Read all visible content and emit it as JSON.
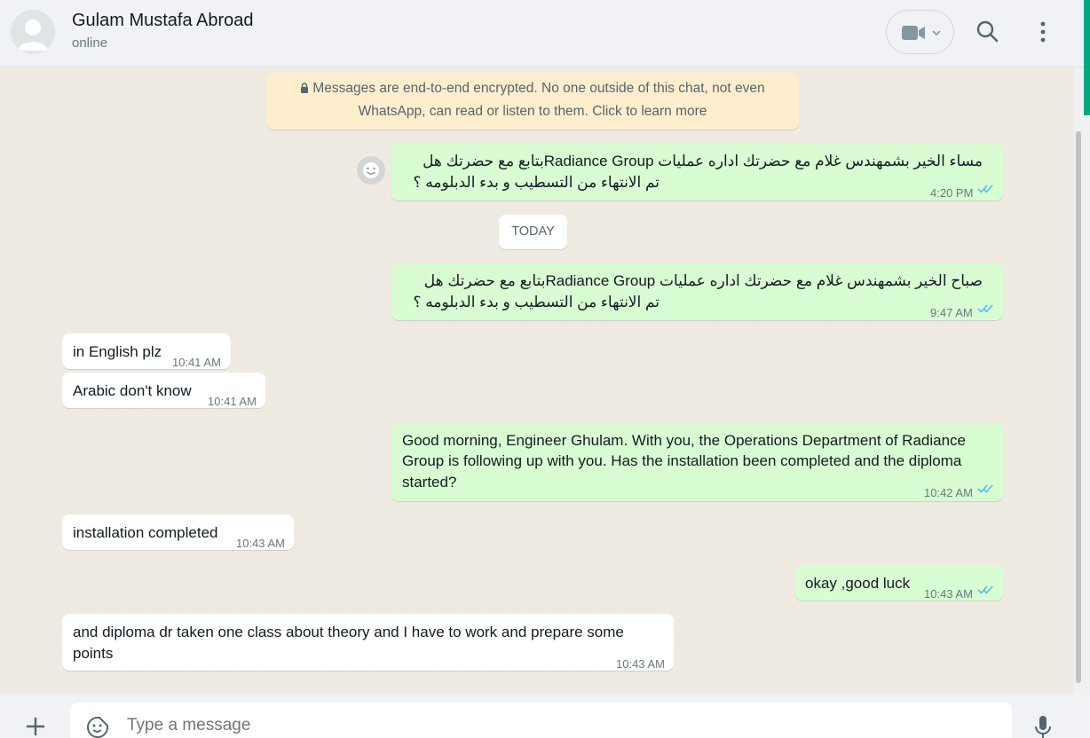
{
  "header": {
    "contact_name": "Gulam Mustafa Abroad",
    "status": "online",
    "icons": [
      "avatar",
      "video-call-icon",
      "chevron-down-icon",
      "search-icon",
      "menu-icon"
    ]
  },
  "encryption_notice": {
    "line1": "Messages are end-to-end encrypted. No one outside of this chat, not even",
    "line2": "WhatsApp, can read or listen to them. Click to learn more"
  },
  "date_separator": "TODAY",
  "messages": [
    {
      "direction": "out",
      "line1": "مساء الخير بشمهندس غلام مع  حضرتك اداره عمليات Radiance Groupبتابع مع حضرتك هل",
      "line2": "تم الانتهاء من التسطيب و بدء الدبلومه ؟",
      "time": "4:20 PM",
      "status": "read"
    },
    {
      "direction": "out",
      "line1": "صباح الخير بشمهندس غلام مع  حضرتك اداره عمليات Radiance Groupبتابع مع حضرتك هل",
      "line2": "تم الانتهاء من التسطيب و بدء الدبلومه ؟",
      "time": "9:47 AM",
      "status": "read"
    },
    {
      "direction": "in",
      "text": "in English plz",
      "time": "10:41 AM"
    },
    {
      "direction": "in",
      "text": "Arabic don't know",
      "time": "10:41 AM"
    },
    {
      "direction": "out",
      "line1": "Good morning, Engineer Ghulam. With you, the Operations Department of Radiance",
      "line2": "Group is following up with you. Has the installation been completed and the diploma",
      "line3": "started?",
      "time": "10:42 AM",
      "status": "read"
    },
    {
      "direction": "in",
      "text": "installation completed",
      "time": "10:43 AM"
    },
    {
      "direction": "out",
      "text": "okay ,good luck",
      "time": "10:43 AM",
      "status": "read"
    },
    {
      "direction": "in",
      "line1": "and diploma dr taken one class about theory and I have to work and prepare some",
      "line2": "points",
      "time": "10:43 AM"
    }
  ],
  "composer": {
    "placeholder": "Type a message"
  },
  "colors": {
    "outgoing_bubble": "#d9fdd3",
    "incoming_bubble": "#ffffff",
    "read_ticks": "#53bdeb",
    "accent": "#00a884",
    "encryption_notice_bg": "#ffeecd"
  }
}
